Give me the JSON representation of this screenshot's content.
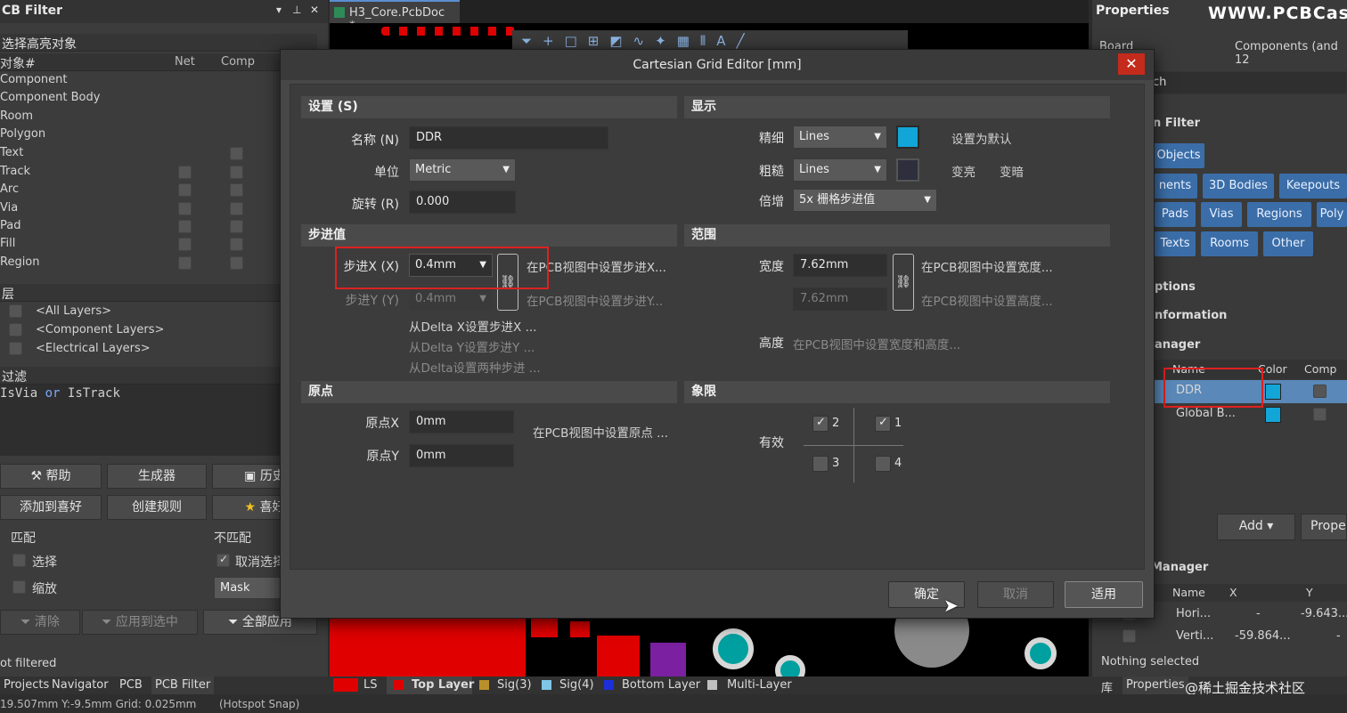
{
  "left_panel": {
    "title": "CB Filter",
    "ctrl_pin": "▾",
    "ctrl_dock": "📌",
    "ctrl_close": "✕",
    "section_objects": "选择高亮对象",
    "col_object": "对象#",
    "col_net": "Net",
    "col_comp": "Comp",
    "objects": [
      "Component",
      "Component Body",
      "Room",
      "Polygon",
      "Text",
      "Track",
      "Arc",
      "Via",
      "Pad",
      "Fill",
      "Region"
    ],
    "section_layers": "层",
    "layers": [
      "<All Layers>",
      "<Component Layers>",
      "<Electrical Layers>"
    ],
    "section_filter": "过滤",
    "filter_a": "IsVia",
    "filter_op": "or",
    "filter_b": "IsTrack",
    "btn_help": "帮助",
    "btn_builder": "生成器",
    "btn_history": "历史",
    "btn_add_fav": "添加到喜好",
    "btn_create_rule": "创建规则",
    "btn_fav": "喜好",
    "match_label": "匹配",
    "nomatch_label": "不匹配",
    "select_label": "选择",
    "zoom_label": "缩放",
    "deselect_label": "取消选择",
    "mask_value": "Mask",
    "btn_clear": "清除",
    "btn_apply_sel": "应用到选中",
    "btn_apply_all": "全部应用",
    "status_filtered": "ot filtered"
  },
  "document": {
    "tab_label": "H3_Core.PcbDoc *"
  },
  "right_panel": {
    "title": "Properties",
    "watermark": "WWW.PCBCas",
    "board_label": "Board",
    "components_label": "Components (and 12",
    "search_placeholder": "ch",
    "selection_filter": "n Filter",
    "btn_objects": "Objects",
    "btn_components": "nents",
    "btn_3d_bodies": "3D Bodies",
    "btn_keepouts": "Keepouts",
    "btn_pads": "Pads",
    "btn_vias": "Vias",
    "btn_regions": "Regions",
    "btn_poly": "Poly",
    "btn_texts": "Texts",
    "btn_rooms": "Rooms",
    "btn_other": "Other",
    "options": "ptions",
    "information": "nformation",
    "grid_manager": "anager",
    "col_name": "Name",
    "col_color": "Color",
    "col_comp": "Comp",
    "grid_rows": [
      {
        "name": "DDR",
        "color": "#12a5d8"
      },
      {
        "name": "Global B...",
        "color": "#12a5d8"
      }
    ],
    "btn_add": "Add ▾",
    "btn_props": "Prope",
    "guide_manager": "Manager",
    "guide_col_name": "Name",
    "guide_col_x": "X",
    "guide_col_y": "Y",
    "guides": [
      {
        "name": "Hori...",
        "x": "-",
        "y": "-9.643..."
      },
      {
        "name": "Verti...",
        "x": "-59.864...",
        "y": "-"
      }
    ],
    "nothing_selected": "Nothing selected"
  },
  "dialog": {
    "title": "Cartesian Grid Editor [mm]",
    "close": "✕",
    "settings_head": "设置 (S)",
    "name_label": "名称 (N)",
    "name_value": "DDR",
    "unit_label": "单位",
    "unit_value": "Metric",
    "rotation_label": "旋转 (R)",
    "rotation_value": "0.000",
    "display_head": "显示",
    "fine_label": "精细",
    "fine_value": "Lines",
    "fine_color": "#12a5d8",
    "coarse_label": "粗糙",
    "coarse_value": "Lines",
    "coarse_color": "#2d2f3c",
    "set_default": "设置为默认",
    "lighten": "变亮",
    "darken": "变暗",
    "multiplier_label": "倍增",
    "multiplier_value": "5x 栅格步进值",
    "step_head": "步进值",
    "stepx_label": "步进X (X)",
    "stepx_value": "0.4mm",
    "stepy_label": "步进Y (Y)",
    "stepy_value": "0.4mm",
    "stepx_hint": "在PCB视图中设置步进X...",
    "stepy_hint": "在PCB视图中设置步进Y...",
    "delta_x": "从Delta X设置步进X ...",
    "delta_y": "从Delta Y设置步进Y ...",
    "delta_both": "从Delta设置两种步进 ...",
    "range_head": "范围",
    "width_label": "宽度",
    "width_value": "7.62mm",
    "height_value": "7.62mm",
    "width_hint": "在PCB视图中设置宽度...",
    "height_hint": "在PCB视图中设置高度...",
    "height_label": "高度",
    "both_hint": "在PCB视图中设置宽度和高度...",
    "origin_head": "原点",
    "originx_label": "原点X",
    "originx_value": "0mm",
    "originy_label": "原点Y",
    "originy_value": "0mm",
    "origin_hint": "在PCB视图中设置原点 ...",
    "quadrant_head": "象限",
    "valid_label": "有效",
    "q1": "1",
    "q2": "2",
    "q3": "3",
    "q4": "4",
    "btn_ok": "确定",
    "btn_cancel": "取消",
    "btn_apply": "适用"
  },
  "bottom_tabs": {
    "projects": "Projects",
    "navigator": "Navigator",
    "pcb": "PCB",
    "pcb_filter": "PCB Filter",
    "ls": "LS",
    "top_layer": "Top Layer",
    "sig3": "Sig(3)",
    "sig4": "Sig(4)",
    "bottom_layer": "Bottom Layer",
    "multi_layer": "Multi-Layer",
    "lib": "库",
    "properties": "Properties",
    "watermark": "@稀土掘金技术社区",
    "colors": {
      "top": "#e00000",
      "sig3": "#b8902a",
      "sig4": "#7fc6e6",
      "bottom": "#1d2fd8",
      "multi": "#c0c0c0"
    }
  },
  "status_bar": {
    "coords": "19.507mm Y:-9.5mm   Grid: 0.025mm",
    "snap": "(Hotspot Snap)"
  }
}
